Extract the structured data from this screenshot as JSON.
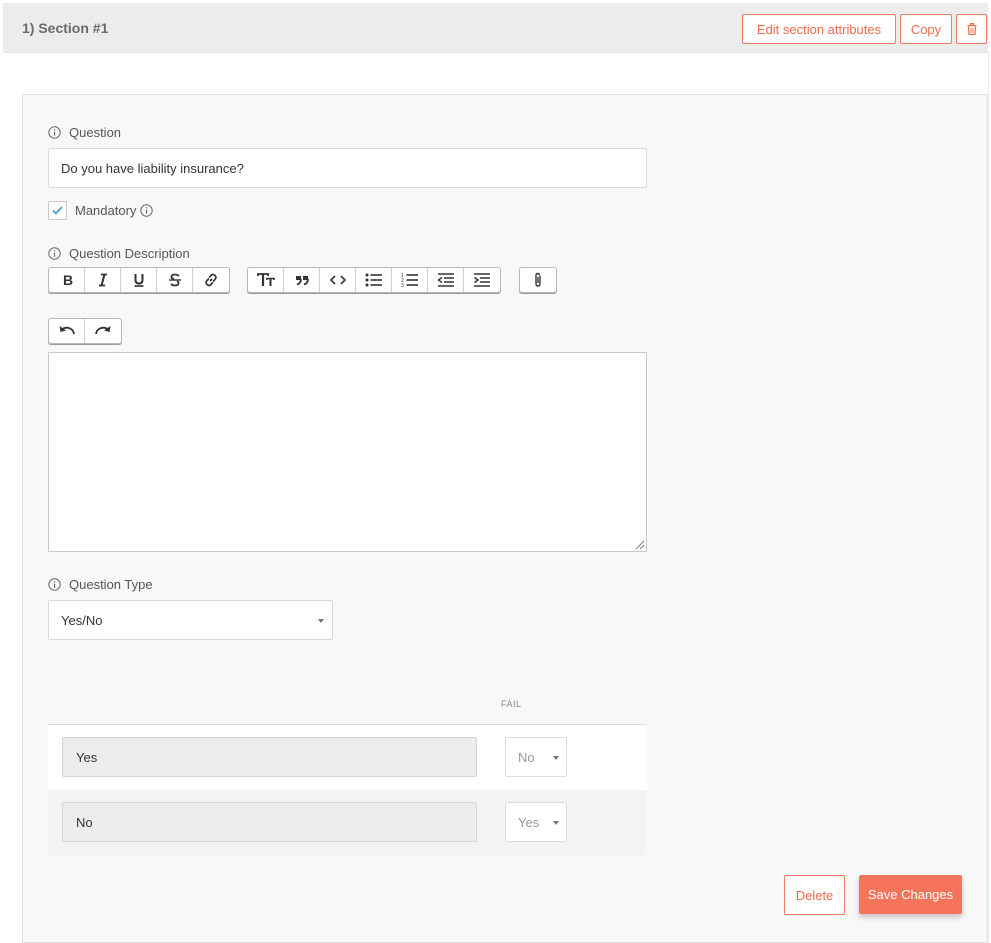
{
  "section": {
    "title": "1) Section #1",
    "edit_label": "Edit section attributes",
    "copy_label": "Copy",
    "delete_icon": "trash-icon"
  },
  "question": {
    "label": "Question",
    "value": "Do you have liability insurance?",
    "mandatory_label": "Mandatory",
    "mandatory_checked": true,
    "description_label": "Question Description",
    "description_value": "",
    "type_label": "Question Type",
    "type_value": "Yes/No"
  },
  "toolbar": {
    "group1": [
      "bold-icon",
      "italic-icon",
      "underline-icon",
      "strikethrough-icon",
      "link-icon"
    ],
    "group2": [
      "heading-icon",
      "quote-icon",
      "code-icon",
      "bullet-list-icon",
      "numbered-list-icon",
      "outdent-icon",
      "indent-icon"
    ],
    "group3": [
      "attachment-icon"
    ],
    "group4": [
      "undo-icon",
      "redo-icon"
    ]
  },
  "answers": {
    "fail_header": "FAIL",
    "rows": [
      {
        "answer": "Yes",
        "fail": "No"
      },
      {
        "answer": "No",
        "fail": "Yes"
      }
    ]
  },
  "actions": {
    "delete_label": "Delete",
    "save_label": "Save Changes"
  },
  "colors": {
    "accent": "#f7745a",
    "accent_text": "#ef6a4c",
    "check": "#4a9fd8"
  }
}
